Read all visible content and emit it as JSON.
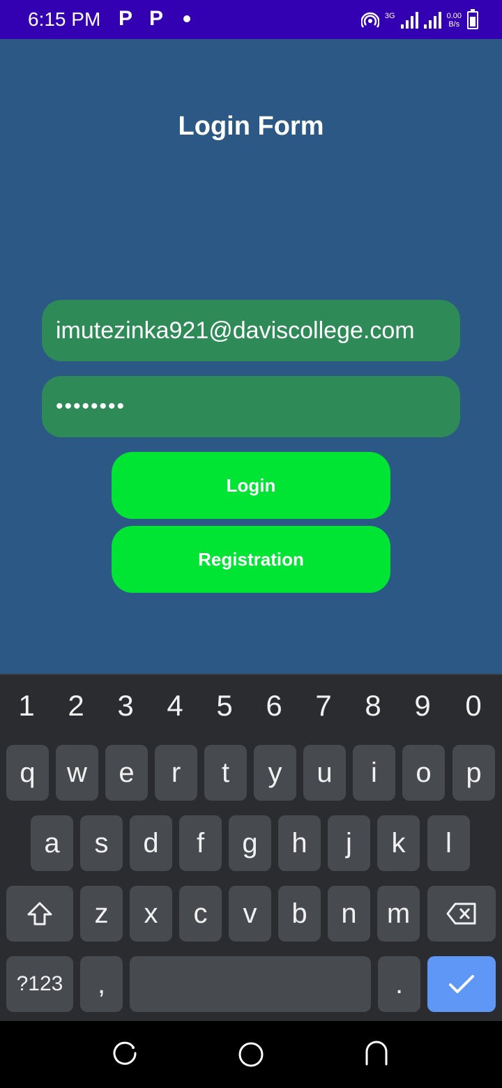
{
  "status_bar": {
    "time": "6:15 PM",
    "notif_icons": [
      "P",
      "P"
    ],
    "network_type": "3G",
    "speed_value": "0.00",
    "speed_unit": "B/s"
  },
  "form": {
    "title": "Login Form",
    "email_value": "imutezinka921@daviscollege.com",
    "password_value": "••••••••",
    "login_label": "Login",
    "registration_label": "Registration"
  },
  "keyboard": {
    "numbers": [
      "1",
      "2",
      "3",
      "4",
      "5",
      "6",
      "7",
      "8",
      "9",
      "0"
    ],
    "row1": [
      "q",
      "w",
      "e",
      "r",
      "t",
      "y",
      "u",
      "i",
      "o",
      "p"
    ],
    "row2": [
      "a",
      "s",
      "d",
      "f",
      "g",
      "h",
      "j",
      "k",
      "l"
    ],
    "row3": [
      "z",
      "x",
      "c",
      "v",
      "b",
      "n",
      "m"
    ],
    "symbols_label": "?123",
    "comma": ",",
    "period": "."
  },
  "colors": {
    "background": "#2c5885",
    "status_bar": "#3300b2",
    "field": "#2e8b57",
    "button": "#00e434",
    "keyboard_bg": "#2a2c30",
    "key": "#474a4f",
    "enter_key": "#5e97f6"
  }
}
